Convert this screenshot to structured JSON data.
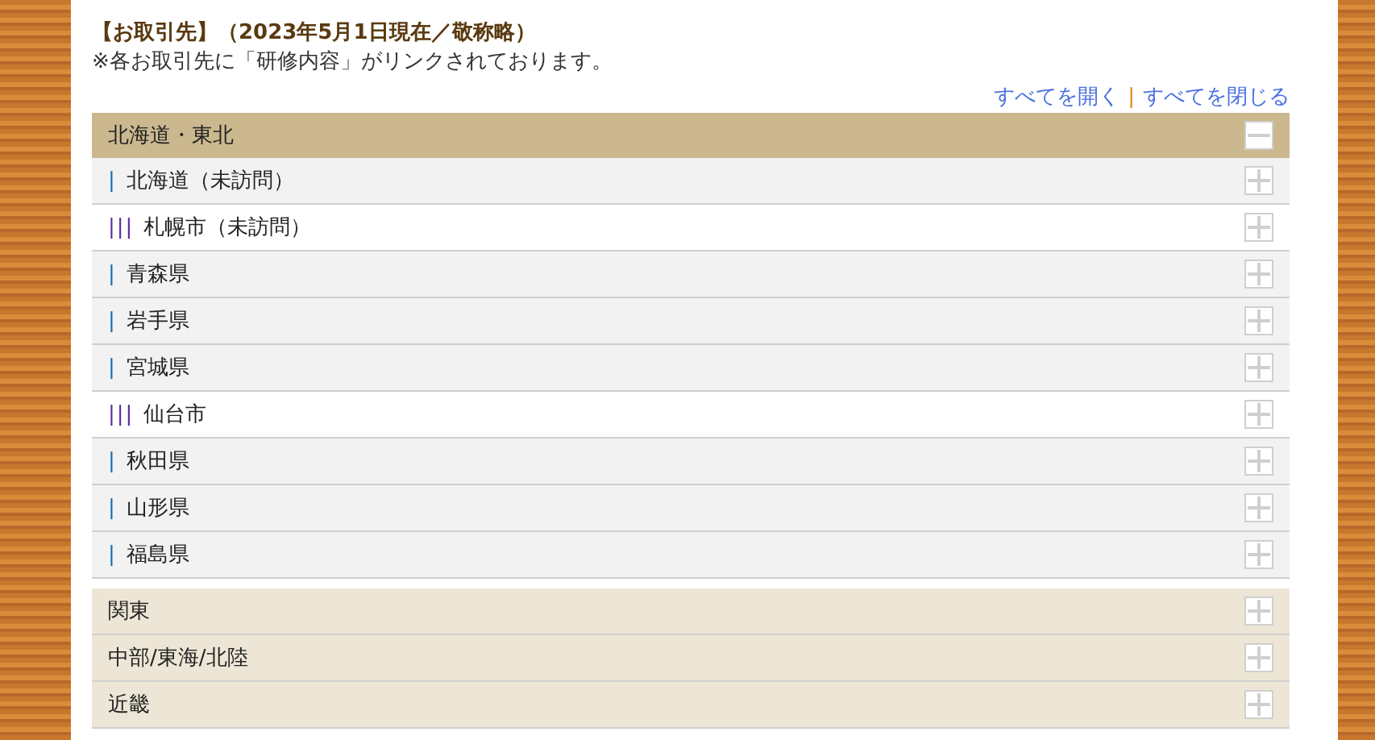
{
  "heading": {
    "title": "【お取引先】（2023年5月1日現在／敬称略）",
    "note": "※各お取引先に「研修内容」がリンクされております。"
  },
  "controls": {
    "open_all": "すべてを開く",
    "separator": "|",
    "close_all": "すべてを閉じる"
  },
  "groups": [
    {
      "label": "北海道・東北",
      "expanded": true,
      "children": [
        {
          "kind": "prefecture",
          "marker": "|",
          "label": "北海道（未訪問）",
          "expanded": false
        },
        {
          "kind": "city",
          "marker": "|||",
          "label": "札幌市（未訪問）",
          "expanded": false
        },
        {
          "kind": "prefecture",
          "marker": "|",
          "label": "青森県",
          "expanded": false
        },
        {
          "kind": "prefecture",
          "marker": "|",
          "label": "岩手県",
          "expanded": false
        },
        {
          "kind": "prefecture",
          "marker": "|",
          "label": "宮城県",
          "expanded": false
        },
        {
          "kind": "city",
          "marker": "|||",
          "label": "仙台市",
          "expanded": false
        },
        {
          "kind": "prefecture",
          "marker": "|",
          "label": "秋田県",
          "expanded": false
        },
        {
          "kind": "prefecture",
          "marker": "|",
          "label": "山形県",
          "expanded": false
        },
        {
          "kind": "prefecture",
          "marker": "|",
          "label": "福島県",
          "expanded": false
        }
      ]
    },
    {
      "label": "関東",
      "expanded": false
    },
    {
      "label": "中部/東海/北陸",
      "expanded": false
    },
    {
      "label": "近畿",
      "expanded": false
    }
  ]
}
